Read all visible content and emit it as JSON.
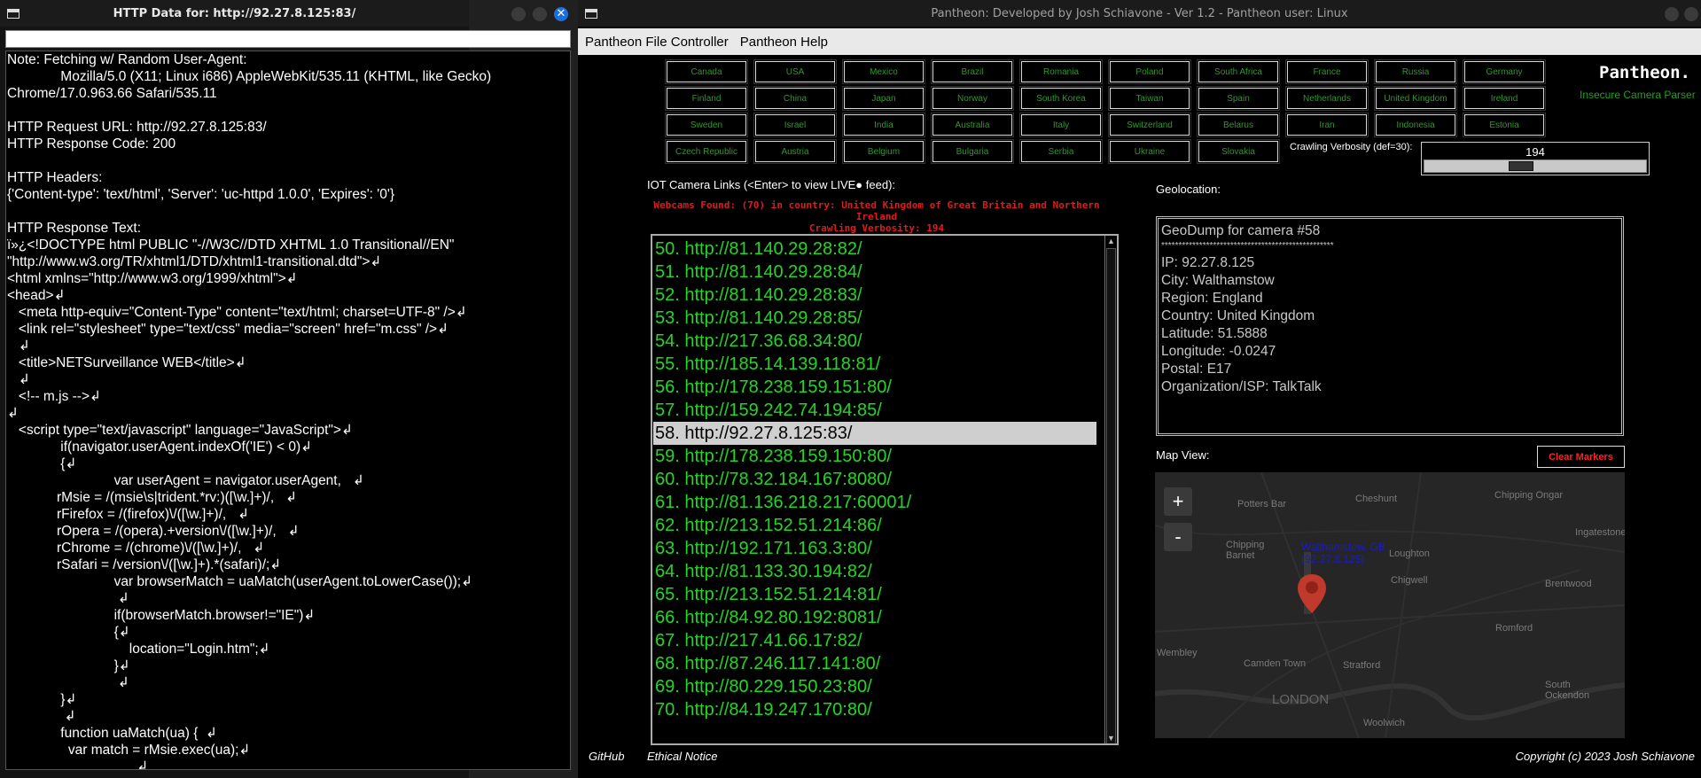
{
  "left_window": {
    "title": "HTTP Data for: http://92.27.8.125:83/",
    "url_value": "",
    "lines": [
      "Note: Fetching w/ Random User-Agent:",
      "              Mozilla/5.0 (X11; Linux i686) AppleWebKit/535.11 (KHTML, like Gecko)",
      "Chrome/17.0.963.66 Safari/535.11",
      "",
      "HTTP Request URL: http://92.27.8.125:83/",
      "HTTP Response Code: 200",
      "",
      "HTTP Headers:",
      "{'Content-type': 'text/html', 'Server': 'uc-httpd 1.0.0', 'Expires': '0'}",
      "",
      "HTTP Response Text:",
      "ï»¿<!DOCTYPE html PUBLIC \"-//W3C//DTD XHTML 1.0 Transitional//EN\"",
      "\"http://www.w3.org/TR/xhtml1/DTD/xhtml1-transitional.dtd\">↲",
      "<html xmlns=\"http://www.w3.org/1999/xhtml\">↲",
      "<head>↲",
      "   <meta http-equiv=\"Content-Type\" content=\"text/html; charset=UTF-8\" />↲",
      "   <link rel=\"stylesheet\" type=\"text/css\" media=\"screen\" href=\"m.css\" />↲",
      "   ↲",
      "   <title>NETSurveillance WEB</title>↲",
      "   ↲",
      "   <!-- m.js -->↲",
      "↲",
      "   <script type=\"text/javascript\" language=\"JavaScript\">↲",
      "              if(navigator.userAgent.indexOf('IE') < 0)↲",
      "              {↲",
      "                            var userAgent = navigator.userAgent,   ↲",
      "             rMsie = /(msie\\s|trident.*rv:)([\\w.]+)/,   ↲",
      "             rFirefox = /(firefox)\\/([\\w.]+)/,   ↲",
      "             rOpera = /(opera).+version\\/([\\w.]+)/,   ↲",
      "             rChrome = /(chrome)\\/([\\w.]+)/,   ↲",
      "             rSafari = /version\\/([\\w.]+).*(safari)/;↲",
      "                            var browserMatch = uaMatch(userAgent.toLowerCase());↲",
      "                             ↲",
      "                            if(browserMatch.browser!=\"IE\")↲",
      "                            {↲",
      "                                location=\"Login.htm\";↲",
      "                            }↲",
      "                             ↲",
      "              }↲",
      "               ↲",
      "              function uaMatch(ua) {  ↲",
      "                var match = rMsie.exec(ua);↲",
      "                                  ↲"
    ]
  },
  "right_window": {
    "title": "Pantheon: Developed by Josh Schiavone - Ver 1.2 - Pantheon user: Linux",
    "menu": [
      "Pantheon File Controller",
      "Pantheon Help"
    ],
    "countries": [
      "Canada",
      "USA",
      "Mexico",
      "Brazil",
      "Romania",
      "Poland",
      "South Africa",
      "France",
      "Russia",
      "Germany",
      "Finland",
      "China",
      "Japan",
      "Norway",
      "South Korea",
      "Taiwan",
      "Spain",
      "Netherlands",
      "United Kingdom",
      "Ireland",
      "Sweden",
      "Israel",
      "India",
      "Australia",
      "Italy",
      "Switzerland",
      "Belarus",
      "Iran",
      "Indonesia",
      "Estonia",
      "Czech Republic",
      "Austria",
      "Belgium",
      "Bulgaria",
      "Serbia",
      "Ukraine",
      "Slovakia"
    ],
    "brand": "Pantheon.",
    "brand_sub": "Insecure Camera Parser",
    "verbosity_label": "Crawling Verbosity (def=30):",
    "verbosity_value": "194",
    "verbosity_fraction": 0.43,
    "iot_label": "IOT Camera Links (<Enter> to view LIVE● feed):",
    "found_line1": "Webcams Found: (70) in country: United Kingdom of Great Britain and Northern Ireland",
    "found_line2": "Crawling Verbosity: 194",
    "links": [
      "50. http://81.140.29.28:82/",
      "51. http://81.140.29.28:84/",
      "52. http://81.140.29.28:83/",
      "53. http://81.140.29.28:85/",
      "54. http://217.36.68.34:80/",
      "55. http://185.14.139.118:81/",
      "56. http://178.238.159.151:80/",
      "57. http://159.242.74.194:85/",
      "58. http://92.27.8.125:83/",
      "59. http://178.238.159.150:80/",
      "60. http://78.32.184.167:8080/",
      "61. http://81.136.218.217:60001/",
      "62. http://213.152.51.214:86/",
      "63. http://192.171.163.3:80/",
      "64. http://81.133.30.194:82/",
      "65. http://213.152.51.214:81/",
      "66. http://84.92.80.192:8081/",
      "67. http://217.41.66.17:82/",
      "68. http://87.246.117.141:80/",
      "69. http://80.229.150.23:80/",
      "70. http://84.19.247.170:80/"
    ],
    "selected_index": 8,
    "geo_label": "Geolocation:",
    "geo_lines": [
      "GeoDump for camera #58",
      "**************************************************",
      "IP: 92.27.8.125",
      "City: Walthamstow",
      "Region: England",
      "Country: United Kingdom",
      "Latitude: 51.5888",
      "Longitude: -0.0247",
      "Postal: E17",
      "Organization/ISP: TalkTalk"
    ],
    "map_label": "Map View:",
    "clear_label": "Clear Markers",
    "zoom_in": "+",
    "zoom_out": "-",
    "marker_label_1": "Walthamstow, GB",
    "marker_label_2": "(92.27.8.125)",
    "map_places": [
      "Potters Bar",
      "Cheshunt",
      "Chipping Ongar",
      "Ingatestone",
      "Chipping Barnet",
      "Loughton",
      "Chigwell",
      "Brentwood",
      "Romford",
      "Wembley",
      "Camden Town",
      "Stratford",
      "LONDON",
      "South Ockendon",
      "Woolwich"
    ],
    "github": "GitHub",
    "ethical": "Ethical Notice",
    "copyright": "Copyright (c) 2023 Josh Schiavone",
    "accent_green": "#23d623",
    "accent_red": "#e01b1b"
  }
}
